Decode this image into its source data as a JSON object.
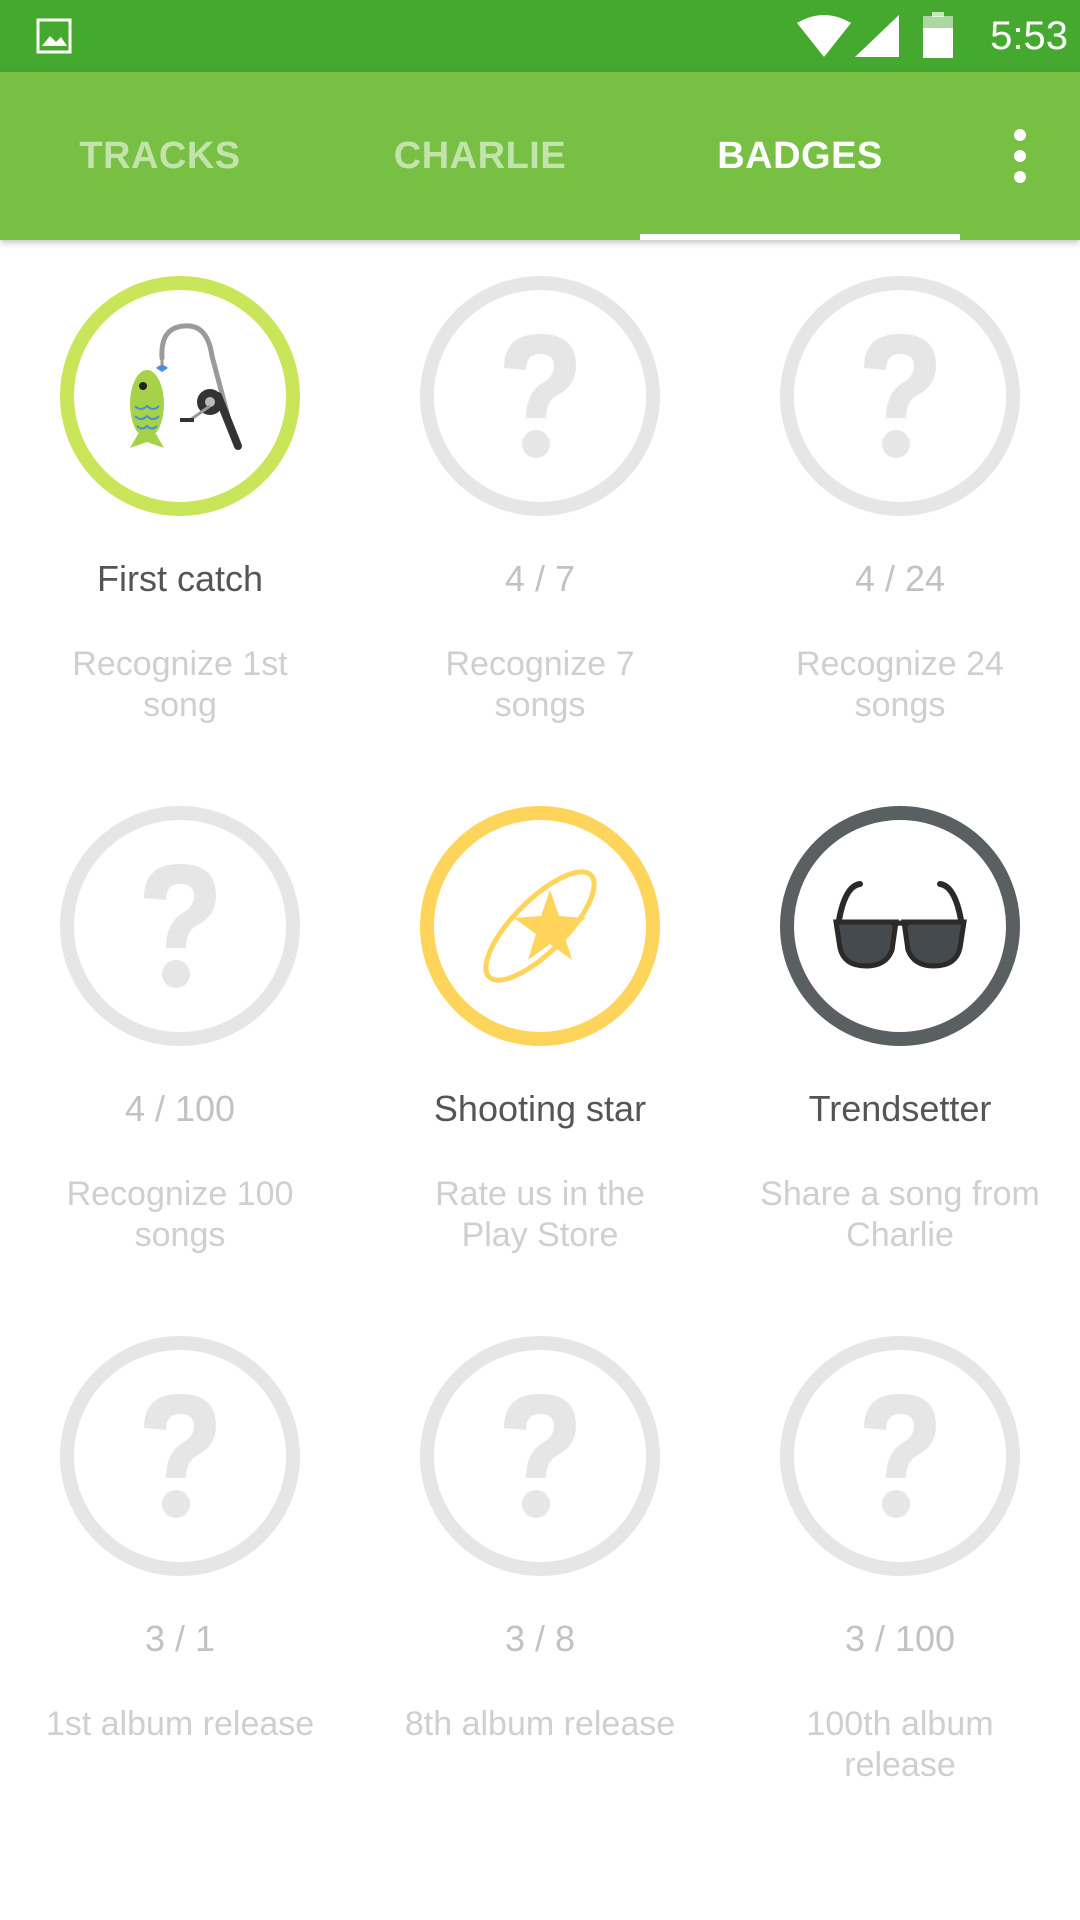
{
  "status_bar": {
    "time": "5:53",
    "icons": [
      "image-notification-icon",
      "wifi-icon",
      "cell-signal-icon",
      "battery-icon"
    ]
  },
  "tabs": [
    {
      "label": "TRACKS",
      "active": false
    },
    {
      "label": "CHARLIE",
      "active": false
    },
    {
      "label": "BADGES",
      "active": true
    }
  ],
  "colors": {
    "status_bar": "#45a82f",
    "app_bar": "#78c043",
    "locked_ring": "#e6e6e6",
    "first_catch_ring": "#c9e55a",
    "shooting_star_ring": "#ffd45a",
    "trendsetter_ring": "#5a5f62"
  },
  "badges": [
    {
      "title": "First catch",
      "description": "Recognize 1st song",
      "icon": "fishing-rod-fish-icon",
      "earned": true
    },
    {
      "title": "4 / 7",
      "description": "Recognize 7 songs",
      "icon": "question-mark-icon",
      "earned": false
    },
    {
      "title": "4 / 24",
      "description": "Recognize 24 songs",
      "icon": "question-mark-icon",
      "earned": false
    },
    {
      "title": "4 / 100",
      "description": "Recognize 100 songs",
      "icon": "question-mark-icon",
      "earned": false
    },
    {
      "title": "Shooting star",
      "description": "Rate us in the Play Store",
      "icon": "shooting-star-icon",
      "earned": true
    },
    {
      "title": "Trendsetter",
      "description": "Share a song from Charlie",
      "icon": "sunglasses-icon",
      "earned": true
    },
    {
      "title": "3 / 1",
      "description": "1st album release",
      "icon": "question-mark-icon",
      "earned": false
    },
    {
      "title": "3 / 8",
      "description": "8th album release",
      "icon": "question-mark-icon",
      "earned": false
    },
    {
      "title": "3 / 100",
      "description": "100th album release",
      "icon": "question-mark-icon",
      "earned": false
    }
  ]
}
